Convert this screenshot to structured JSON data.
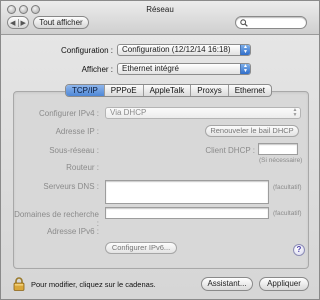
{
  "window": {
    "title": "Réseau",
    "show_all_label": "Tout afficher",
    "back_glyph": "◀",
    "forward_glyph": "▶",
    "search_placeholder": ""
  },
  "config": {
    "configuration_label": "Configuration :",
    "configuration_value": "Configuration (12/12/14 16:18)",
    "afficher_label": "Afficher :",
    "afficher_value": "Ethernet intégré"
  },
  "tabs": [
    {
      "label": "TCP/IP",
      "active": true
    },
    {
      "label": "PPPoE",
      "active": false
    },
    {
      "label": "AppleTalk",
      "active": false
    },
    {
      "label": "Proxys",
      "active": false
    },
    {
      "label": "Ethernet",
      "active": false
    }
  ],
  "tcpip": {
    "configure_ipv4_label": "Configurer IPv4 :",
    "configure_ipv4_value": "Via DHCP",
    "ip_address_label": "Adresse IP :",
    "renew_dhcp_label": "Renouveler le bail DHCP",
    "subnet_label": "Sous-réseau :",
    "dhcp_client_label": "Client DHCP :",
    "if_needed_note": "(Si nécessaire)",
    "router_label": "Routeur :",
    "dns_label": "Serveurs DNS :",
    "optional_dns": "(facultatif)",
    "search_domains_label": "Domaines de recherche :",
    "optional_domains": "(facultatif)",
    "ipv6_label": "Adresse IPv6 :",
    "configure_ipv6_label": "Configurer IPv6..."
  },
  "footer": {
    "lock_text": "Pour modifier, cliquez sur le cadenas.",
    "assistant_label": "Assistant...",
    "apply_label": "Appliquer"
  },
  "help_glyph": "?",
  "colors": {
    "accent_blue": "#4e87d6",
    "disabled_text": "#8b8b8b"
  }
}
